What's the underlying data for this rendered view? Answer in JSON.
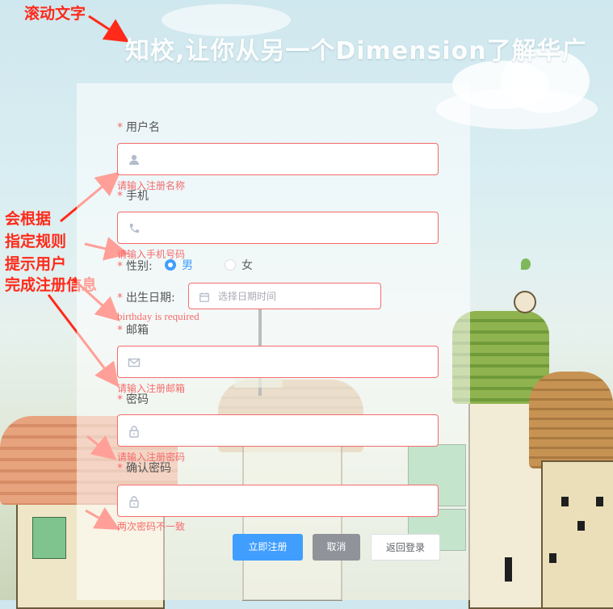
{
  "annotations": {
    "scroll_text": "滚动文字",
    "rule_hint": [
      "会根据",
      "指定规则",
      "提示用户",
      "完成注册信息"
    ]
  },
  "banner": "知校,让你从另一个Dimension了解华广",
  "form": {
    "username": {
      "label": "用户名",
      "placeholder": "",
      "value": "",
      "error": "请输入注册名称",
      "icon": "user-icon"
    },
    "phone": {
      "label": "手机",
      "placeholder": "",
      "value": "",
      "error": "请输入手机号码",
      "icon": "phone-icon"
    },
    "gender": {
      "label": "性别:",
      "options": [
        "男",
        "女"
      ],
      "selected": "男"
    },
    "birthday": {
      "label": "出生日期:",
      "placeholder": "选择日期时间",
      "value": "",
      "error": "birthday is required",
      "icon": "calendar-icon"
    },
    "email": {
      "label": "邮箱",
      "placeholder": "",
      "value": "",
      "error": "请输入注册邮箱",
      "icon": "mail-icon"
    },
    "password": {
      "label": "密码",
      "placeholder": "",
      "value": "",
      "error": "请输入注册密码",
      "icon": "lock-icon"
    },
    "confirm": {
      "label": "确认密码",
      "placeholder": "",
      "value": "",
      "error": "两次密码不一致",
      "icon": "lock-icon"
    }
  },
  "buttons": {
    "register": "立即注册",
    "cancel": "取消",
    "back_login": "返回登录"
  },
  "colors": {
    "error": "#f56c6c",
    "primary": "#409eff",
    "annotation": "#ff2a1a",
    "cancel_bg": "#909399"
  }
}
